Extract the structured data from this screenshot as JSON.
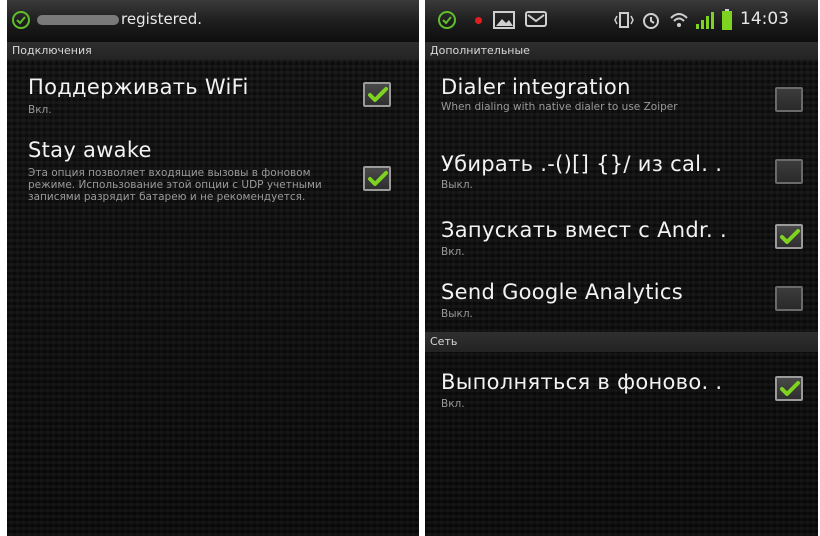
{
  "left_screen": {
    "status": {
      "text": "registered."
    },
    "section_title": "Подключения",
    "prefs": [
      {
        "title": "Поддерживать WiFi",
        "summary": "Вкл.",
        "checked": true
      },
      {
        "title": "Stay awake",
        "summary": "Эта опция позволяет входящие вызовы в фоновом режиме. Использование этой опции с UDP учетными записями разрядит батарею и не рекомендуется.",
        "checked": true
      }
    ]
  },
  "right_screen": {
    "status": {
      "time": "14:03"
    },
    "section_title": "Дополнительные",
    "prefs": [
      {
        "title": "Dialer integration",
        "summary": "When dialing with native dialer to use Zoiper",
        "checked": false
      },
      {
        "title": "Убирать .-()[] {}/ из cal. .",
        "summary": "Выкл.",
        "checked": false
      },
      {
        "title": "Запускать вмест с Andr. .",
        "summary": "Вкл.",
        "checked": true
      },
      {
        "title": "Send Google Analytics",
        "summary": "Выкл.",
        "checked": false
      }
    ],
    "section2_title": "Сеть",
    "prefs2": [
      {
        "title": "Выполняться в фоново. .",
        "summary": "Вкл.",
        "checked": true
      }
    ]
  },
  "colors": {
    "check_green": "#7ed321",
    "status_ok_green": "#5fbf2a",
    "record_red": "#e02020"
  }
}
